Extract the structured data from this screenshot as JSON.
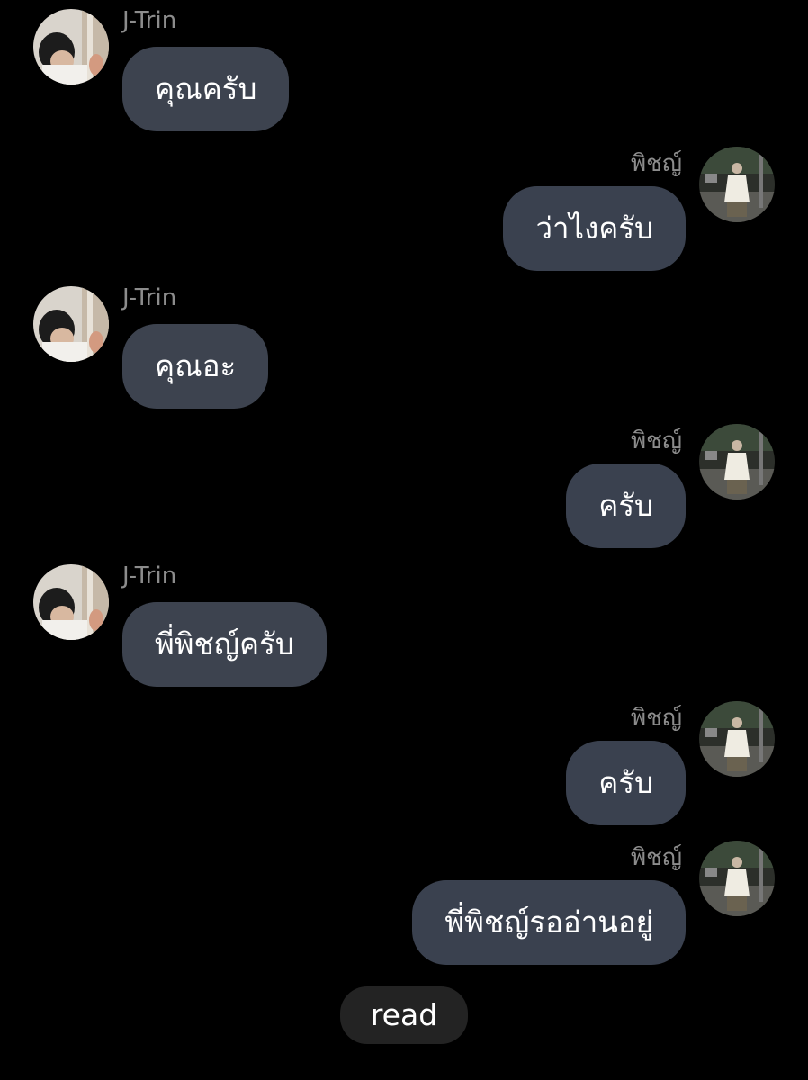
{
  "participants": {
    "left_name": "J-Trin",
    "right_name": "พิชญ์"
  },
  "messages": [
    {
      "side": "left",
      "sender": "J-Trin",
      "text": "คุณครับ"
    },
    {
      "side": "right",
      "sender": "พิชญ์",
      "text": "ว่าไงครับ"
    },
    {
      "side": "left",
      "sender": "J-Trin",
      "text": "คุณอะ"
    },
    {
      "side": "right",
      "sender": "พิชญ์",
      "text": "ครับ"
    },
    {
      "side": "left",
      "sender": "J-Trin",
      "text": "พี่พิชญ์ครับ"
    },
    {
      "side": "right",
      "sender": "พิชญ์",
      "text": "ครับ"
    },
    {
      "side": "right",
      "sender": "พิชญ์",
      "text": "พี่พิชญ์รออ่านอยู่"
    }
  ],
  "status": {
    "read_label": "read"
  },
  "colors": {
    "background": "#000000",
    "bubble": "#3a414f",
    "sender_text": "#8c8c8c",
    "read_pill": "#232323"
  }
}
